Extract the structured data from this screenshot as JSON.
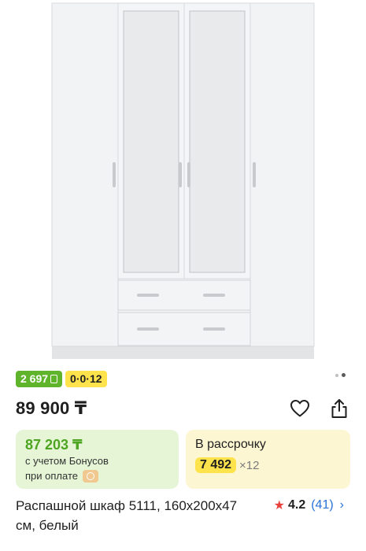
{
  "product": {
    "image_alt": "wardrobe",
    "image_count_dots": 2,
    "badges": {
      "bonus": "2 697",
      "installment": "0·0·12"
    },
    "price": "89 900 ₸",
    "bonus_card": {
      "price": "87 203 ₸",
      "note_line1": "с учетом Бонусов",
      "note_line2": "при оплате"
    },
    "installment_card": {
      "title": "В рассрочку",
      "amount": "7 492",
      "months": "×12"
    },
    "title": "Распашной шкаф 5111, 160х200х47 см, белый",
    "rating": {
      "value": "4.2",
      "count": "(41)"
    }
  },
  "icons": {
    "favorite": "heart-icon",
    "share": "share-icon",
    "star": "star-icon",
    "chevron": "chevron-right-icon",
    "bonus": "bonus-icon",
    "payment": "payment-icon"
  },
  "colors": {
    "bonus_green": "#5fb42c",
    "installment_yellow": "#ffe34d",
    "bonus_card_bg": "#e5f5d6",
    "installment_card_bg": "#fdf6d3",
    "rating_star": "#e8413c",
    "link_blue": "#2a72d6"
  }
}
